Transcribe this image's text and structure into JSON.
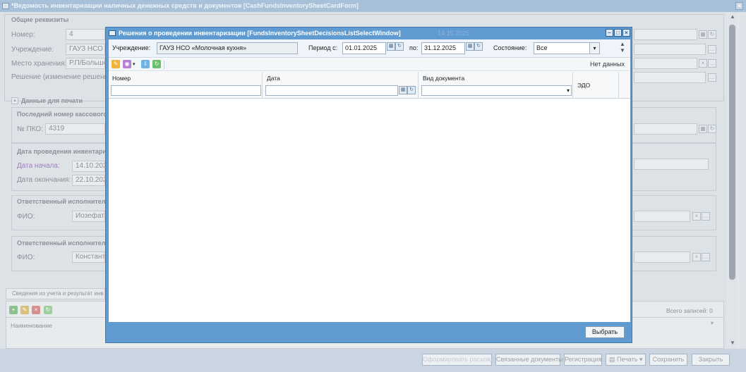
{
  "main_window": {
    "title": "*Ведомость инвентаризации наличных денежных средств и документов [CashFundsInventorySheetCardForm]",
    "section_general": "Общие реквизиты",
    "number_label": "Номер:",
    "number_value": "4",
    "institution_label": "Учреждение:",
    "institution_value": "ГАУЗ НСО «",
    "storage_label": "Место хранения:",
    "storage_value": "Р.П/Больше",
    "decision_label": "Решение (изменение решения)",
    "print_section": "Данные для печати",
    "last_cash_number_label": "Последний номер кассового",
    "pko_label": "№ ПКО:",
    "pko_value": "4319",
    "inventory_date_label": "Дата проведения инвентари",
    "start_date_label": "Дата начала:",
    "start_date_value": "14.10.2025",
    "end_date_label": "Дата окончания:",
    "end_date_value": "22.10.2025",
    "responsible1_label": "Ответственный исполнитель",
    "fio1_label": "ФИО:",
    "fio1_value": "Иозефатов",
    "responsible2_label": "Ответственный исполнитель",
    "fio2_label": "ФИО:",
    "fio2_value": "Константи",
    "accounting_tab": "Сведения из учета и результат инв",
    "total_records": "Всего записей: 0",
    "name_column": "Наименование",
    "background_date": "14.10.2025",
    "buttons": {
      "process_discrepancies": "Оформировать расхожд",
      "related_docs": "Связанные документы",
      "registration": "Регистрация",
      "print": "Печать",
      "save": "Сохранить",
      "close": "Закрыть"
    }
  },
  "modal": {
    "title": "Решения о проведении инвентаризации [FundsInventorySheetDecisionsListSelectWindow]",
    "filters": {
      "institution_label": "Учреждение:",
      "institution_value": "ГАУЗ НСО «Молочная кухня»",
      "period_from_label": "Период с:",
      "period_from_value": "01.01.2025",
      "period_to_label": "по:",
      "period_to_value": "31.12.2025",
      "state_label": "Состояние:",
      "state_value": "Все"
    },
    "no_data": "Нет данных",
    "columns": {
      "number": "Номер",
      "date": "Дата",
      "doc_type": "Вид документа",
      "edo": "ЭДО"
    },
    "select_button": "Выбрать"
  },
  "colors": {
    "modal_frame": "#5f9ad1",
    "main_titlebar": "#a9c1d8",
    "dim_background": "#dde2e7"
  }
}
